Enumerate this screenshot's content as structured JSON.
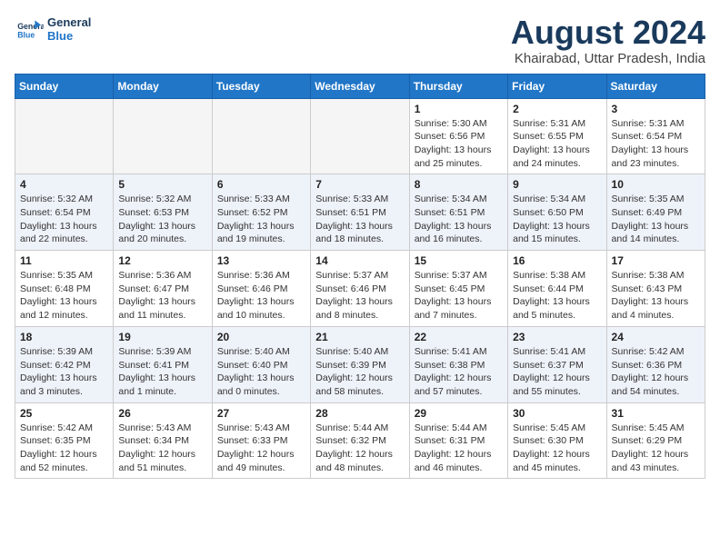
{
  "header": {
    "logo_line1": "General",
    "logo_line2": "Blue",
    "month_title": "August 2024",
    "location": "Khairabad, Uttar Pradesh, India"
  },
  "days_of_week": [
    "Sunday",
    "Monday",
    "Tuesday",
    "Wednesday",
    "Thursday",
    "Friday",
    "Saturday"
  ],
  "weeks": [
    [
      {
        "day": "",
        "detail": ""
      },
      {
        "day": "",
        "detail": ""
      },
      {
        "day": "",
        "detail": ""
      },
      {
        "day": "",
        "detail": ""
      },
      {
        "day": "1",
        "detail": "Sunrise: 5:30 AM\nSunset: 6:56 PM\nDaylight: 13 hours\nand 25 minutes."
      },
      {
        "day": "2",
        "detail": "Sunrise: 5:31 AM\nSunset: 6:55 PM\nDaylight: 13 hours\nand 24 minutes."
      },
      {
        "day": "3",
        "detail": "Sunrise: 5:31 AM\nSunset: 6:54 PM\nDaylight: 13 hours\nand 23 minutes."
      }
    ],
    [
      {
        "day": "4",
        "detail": "Sunrise: 5:32 AM\nSunset: 6:54 PM\nDaylight: 13 hours\nand 22 minutes."
      },
      {
        "day": "5",
        "detail": "Sunrise: 5:32 AM\nSunset: 6:53 PM\nDaylight: 13 hours\nand 20 minutes."
      },
      {
        "day": "6",
        "detail": "Sunrise: 5:33 AM\nSunset: 6:52 PM\nDaylight: 13 hours\nand 19 minutes."
      },
      {
        "day": "7",
        "detail": "Sunrise: 5:33 AM\nSunset: 6:51 PM\nDaylight: 13 hours\nand 18 minutes."
      },
      {
        "day": "8",
        "detail": "Sunrise: 5:34 AM\nSunset: 6:51 PM\nDaylight: 13 hours\nand 16 minutes."
      },
      {
        "day": "9",
        "detail": "Sunrise: 5:34 AM\nSunset: 6:50 PM\nDaylight: 13 hours\nand 15 minutes."
      },
      {
        "day": "10",
        "detail": "Sunrise: 5:35 AM\nSunset: 6:49 PM\nDaylight: 13 hours\nand 14 minutes."
      }
    ],
    [
      {
        "day": "11",
        "detail": "Sunrise: 5:35 AM\nSunset: 6:48 PM\nDaylight: 13 hours\nand 12 minutes."
      },
      {
        "day": "12",
        "detail": "Sunrise: 5:36 AM\nSunset: 6:47 PM\nDaylight: 13 hours\nand 11 minutes."
      },
      {
        "day": "13",
        "detail": "Sunrise: 5:36 AM\nSunset: 6:46 PM\nDaylight: 13 hours\nand 10 minutes."
      },
      {
        "day": "14",
        "detail": "Sunrise: 5:37 AM\nSunset: 6:46 PM\nDaylight: 13 hours\nand 8 minutes."
      },
      {
        "day": "15",
        "detail": "Sunrise: 5:37 AM\nSunset: 6:45 PM\nDaylight: 13 hours\nand 7 minutes."
      },
      {
        "day": "16",
        "detail": "Sunrise: 5:38 AM\nSunset: 6:44 PM\nDaylight: 13 hours\nand 5 minutes."
      },
      {
        "day": "17",
        "detail": "Sunrise: 5:38 AM\nSunset: 6:43 PM\nDaylight: 13 hours\nand 4 minutes."
      }
    ],
    [
      {
        "day": "18",
        "detail": "Sunrise: 5:39 AM\nSunset: 6:42 PM\nDaylight: 13 hours\nand 3 minutes."
      },
      {
        "day": "19",
        "detail": "Sunrise: 5:39 AM\nSunset: 6:41 PM\nDaylight: 13 hours\nand 1 minute."
      },
      {
        "day": "20",
        "detail": "Sunrise: 5:40 AM\nSunset: 6:40 PM\nDaylight: 13 hours\nand 0 minutes."
      },
      {
        "day": "21",
        "detail": "Sunrise: 5:40 AM\nSunset: 6:39 PM\nDaylight: 12 hours\nand 58 minutes."
      },
      {
        "day": "22",
        "detail": "Sunrise: 5:41 AM\nSunset: 6:38 PM\nDaylight: 12 hours\nand 57 minutes."
      },
      {
        "day": "23",
        "detail": "Sunrise: 5:41 AM\nSunset: 6:37 PM\nDaylight: 12 hours\nand 55 minutes."
      },
      {
        "day": "24",
        "detail": "Sunrise: 5:42 AM\nSunset: 6:36 PM\nDaylight: 12 hours\nand 54 minutes."
      }
    ],
    [
      {
        "day": "25",
        "detail": "Sunrise: 5:42 AM\nSunset: 6:35 PM\nDaylight: 12 hours\nand 52 minutes."
      },
      {
        "day": "26",
        "detail": "Sunrise: 5:43 AM\nSunset: 6:34 PM\nDaylight: 12 hours\nand 51 minutes."
      },
      {
        "day": "27",
        "detail": "Sunrise: 5:43 AM\nSunset: 6:33 PM\nDaylight: 12 hours\nand 49 minutes."
      },
      {
        "day": "28",
        "detail": "Sunrise: 5:44 AM\nSunset: 6:32 PM\nDaylight: 12 hours\nand 48 minutes."
      },
      {
        "day": "29",
        "detail": "Sunrise: 5:44 AM\nSunset: 6:31 PM\nDaylight: 12 hours\nand 46 minutes."
      },
      {
        "day": "30",
        "detail": "Sunrise: 5:45 AM\nSunset: 6:30 PM\nDaylight: 12 hours\nand 45 minutes."
      },
      {
        "day": "31",
        "detail": "Sunrise: 5:45 AM\nSunset: 6:29 PM\nDaylight: 12 hours\nand 43 minutes."
      }
    ]
  ]
}
